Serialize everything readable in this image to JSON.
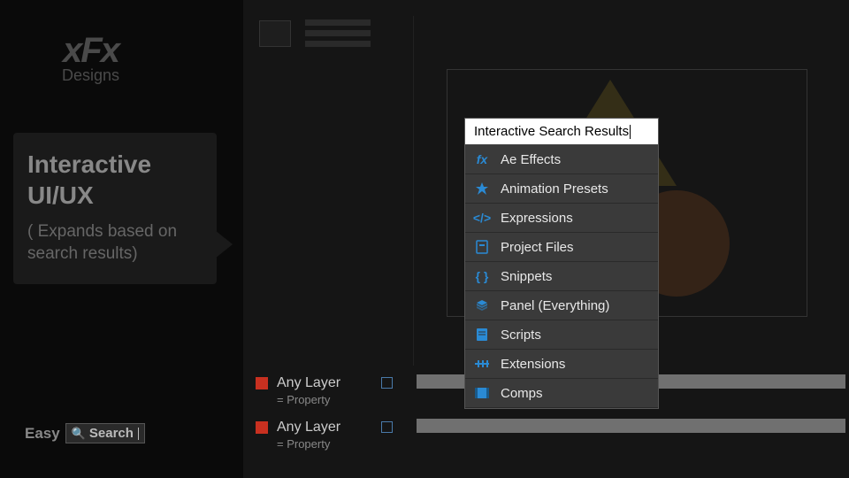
{
  "logo": {
    "mark": "xFx",
    "sub": "Designs"
  },
  "callout": {
    "title_line1": "Interactive",
    "title_line2": "UI/UX",
    "subtitle": "( Expands based on search results)"
  },
  "easy_search": {
    "label": "Easy",
    "field_text": "Search"
  },
  "layers": [
    {
      "name": "Any Layer",
      "prop": "= Property"
    },
    {
      "name": "Any Layer",
      "prop": "= Property"
    }
  ],
  "dropdown": {
    "search_text": "Interactive Search Results",
    "items": [
      {
        "icon": "fx",
        "label": "Ae Effects"
      },
      {
        "icon": "preset",
        "label": "Animation Presets"
      },
      {
        "icon": "code",
        "label": "Expressions"
      },
      {
        "icon": "file",
        "label": "Project Files"
      },
      {
        "icon": "snippet",
        "label": "Snippets"
      },
      {
        "icon": "layers",
        "label": "Panel (Everything)"
      },
      {
        "icon": "script",
        "label": "Scripts"
      },
      {
        "icon": "ext",
        "label": "Extensions"
      },
      {
        "icon": "comp",
        "label": "Comps"
      }
    ]
  }
}
